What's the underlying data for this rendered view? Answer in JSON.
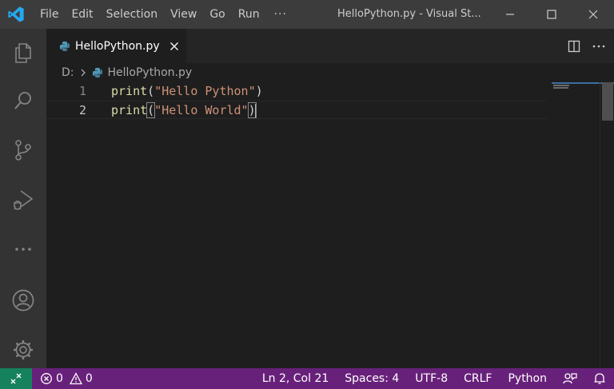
{
  "titlebar": {
    "menus": [
      "File",
      "Edit",
      "Selection",
      "View",
      "Go",
      "Run"
    ],
    "more": "···",
    "window_title": "HelloPython.py - Visual St..."
  },
  "activity_bar": {
    "icons": [
      "files-icon",
      "search-icon",
      "source-control-icon",
      "run-debug-icon",
      "more-icon",
      "account-icon",
      "settings-gear-icon"
    ]
  },
  "tab": {
    "label": "HelloPython.py"
  },
  "breadcrumb": {
    "drive": "D:",
    "file": "HelloPython.py"
  },
  "editor": {
    "lines": [
      {
        "number": "1",
        "fn": "print",
        "open": "(",
        "str": "\"Hello Python\"",
        "close": ")"
      },
      {
        "number": "2",
        "fn": "print",
        "open": "(",
        "str": "\"Hello World\"",
        "close": ")"
      }
    ]
  },
  "statusbar": {
    "errors": "0",
    "warnings": "0",
    "position": "Ln 2, Col 21",
    "spaces": "Spaces: 4",
    "encoding": "UTF-8",
    "eol": "CRLF",
    "language": "Python"
  },
  "colors": {
    "statusbar_bg": "#68217a",
    "remote_bg": "#16825d",
    "editor_bg": "#1e1e1e",
    "activitybar_bg": "#333333",
    "titlebar_bg": "#3c3c3c",
    "accent": "#0078d4"
  }
}
